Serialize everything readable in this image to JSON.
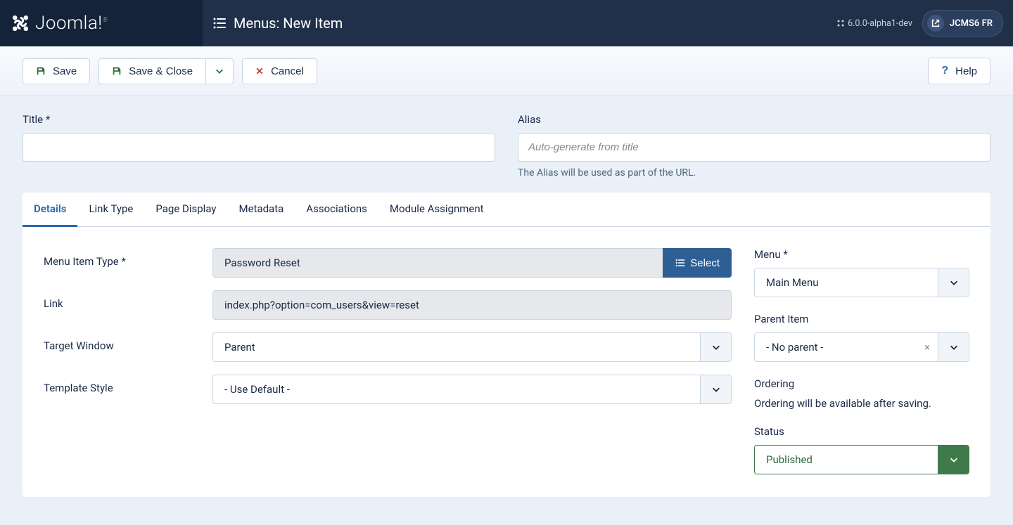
{
  "brand": "Joomla!",
  "page_title": "Menus: New Item",
  "version": "6.0.0-alpha1-dev",
  "site_name": "JCMS6 FR",
  "toolbar": {
    "save": "Save",
    "save_close": "Save & Close",
    "cancel": "Cancel",
    "help": "Help"
  },
  "fields": {
    "title_label": "Title *",
    "title_value": "",
    "alias_label": "Alias",
    "alias_placeholder": "Auto-generate from title",
    "alias_help": "The Alias will be used as part of the URL."
  },
  "tabs": [
    "Details",
    "Link Type",
    "Page Display",
    "Metadata",
    "Associations",
    "Module Assignment"
  ],
  "details": {
    "menu_item_type_label": "Menu Item Type *",
    "menu_item_type_value": "Password Reset",
    "select_btn": "Select",
    "link_label": "Link",
    "link_value": "index.php?option=com_users&view=reset",
    "target_window_label": "Target Window",
    "target_window_value": "Parent",
    "template_style_label": "Template Style",
    "template_style_value": "- Use Default -"
  },
  "sidebar": {
    "menu_label": "Menu *",
    "menu_value": "Main Menu",
    "parent_label": "Parent Item",
    "parent_value": "- No parent -",
    "ordering_label": "Ordering",
    "ordering_text": "Ordering will be available after saving.",
    "status_label": "Status",
    "status_value": "Published"
  }
}
